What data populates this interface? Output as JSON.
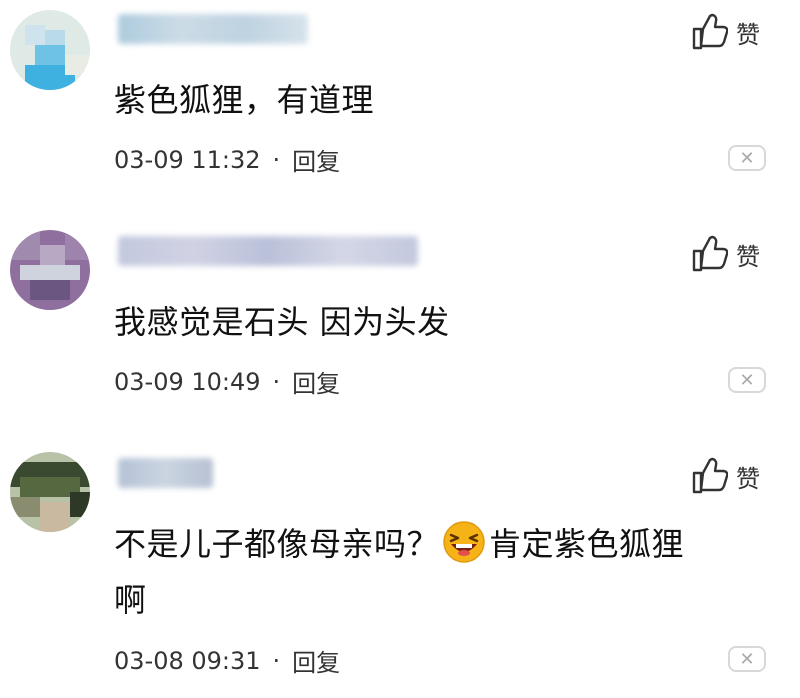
{
  "like_label": "赞",
  "reply_label": "回复",
  "dot": "·",
  "close_symbol": "✕",
  "comments": [
    {
      "text": "紫色狐狸，有道理",
      "time": "03-09 11:32"
    },
    {
      "text": "我感觉是石头 因为头发",
      "time": "03-09 10:49"
    },
    {
      "text_before": "不是儿子都像母亲吗？",
      "text_after": "肯定紫色狐狸",
      "text_wrap": "啊",
      "time": "03-08 09:31"
    }
  ],
  "colors": {
    "avatar1": "#7cc6e8",
    "avatar2": "#8e6f9e",
    "avatar3": "#5a6a4c",
    "emoji": "#f6b318"
  }
}
